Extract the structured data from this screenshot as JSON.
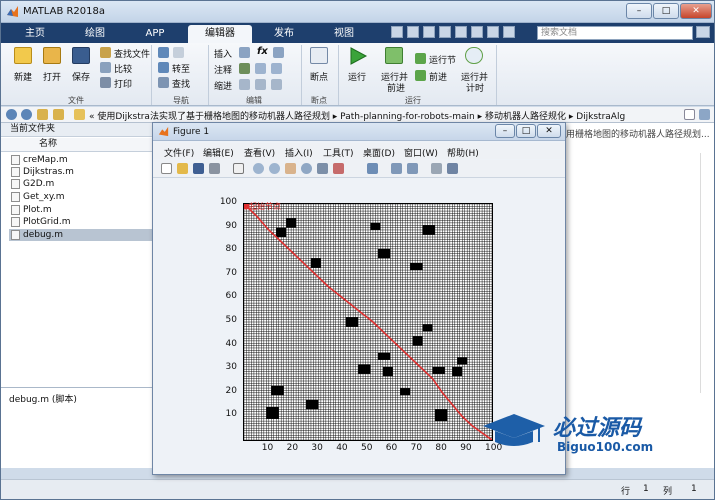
{
  "app": {
    "title": "MATLAB R2018a"
  },
  "window_buttons": {
    "minimize": "–",
    "maximize": "□",
    "close": "✕"
  },
  "tabs": [
    {
      "label": "主页"
    },
    {
      "label": "绘图"
    },
    {
      "label": "APP"
    },
    {
      "label": "编辑器"
    },
    {
      "label": "发布"
    },
    {
      "label": "视图"
    }
  ],
  "search": {
    "placeholder": "搜索文档"
  },
  "ribbon": {
    "file": {
      "new": "新建",
      "open": "打开",
      "save": "保存",
      "find_files": "查找文件",
      "compare": "比较",
      "print": "打印",
      "group": "文件"
    },
    "nav": {
      "goto": "转至",
      "find": "查找",
      "group": "导航"
    },
    "edit": {
      "insert": "插入",
      "comment": "注释",
      "indent": "缩进",
      "fx": "fx",
      "group": "编辑"
    },
    "breakpoints": {
      "label": "断点",
      "group": "断点"
    },
    "run": {
      "run": "运行",
      "run_advance_1": "运行并",
      "run_advance_2": "前进",
      "run_section": "运行节",
      "advance": "前进",
      "run_time_1": "运行并",
      "run_time_2": "计时",
      "group": "运行"
    }
  },
  "address": {
    "path": "«  使用Dijkstra法实现了基于栅格地图的移动机器人路径规划  ▸  Path-planning-for-robots-main  ▸  移动机器人路径规化  ▸  DijkstraAlg"
  },
  "left_panel": {
    "title": "当前文件夹",
    "column": "名称",
    "files": [
      "creMap.m",
      "Dijkstras.m",
      "G2D.m",
      "Get_xy.m",
      "Plot.m",
      "PlotGrid.m",
      "debug.m"
    ],
    "detail": "debug.m  (脚本)"
  },
  "right_panel": {
    "snippet": "用栅格地图的移动机器人路径规划..."
  },
  "status": {
    "row_label": "行",
    "row_value": "1",
    "col_label": "列",
    "col_value": "1"
  },
  "figure": {
    "title": "Figure 1",
    "menu": [
      "文件(F)",
      "编辑(E)",
      "查看(V)",
      "插入(I)",
      "工具(T)",
      "桌面(D)",
      "窗口(W)",
      "帮助(H)"
    ],
    "start_label": "起始节点"
  },
  "chart_data": {
    "type": "scatter",
    "title": "",
    "xlabel": "",
    "ylabel": "",
    "xlim": [
      0,
      100
    ],
    "ylim": [
      0,
      100
    ],
    "xticks": [
      10,
      20,
      30,
      40,
      50,
      60,
      70,
      80,
      90,
      100
    ],
    "yticks": [
      10,
      20,
      30,
      40,
      50,
      60,
      70,
      80,
      90,
      100
    ],
    "grid": "on",
    "obstacles": [
      {
        "x": 17,
        "y": 90,
        "w": 4,
        "h": 4
      },
      {
        "x": 13,
        "y": 86,
        "w": 4,
        "h": 4
      },
      {
        "x": 27,
        "y": 73,
        "w": 4,
        "h": 4
      },
      {
        "x": 51,
        "y": 89,
        "w": 4,
        "h": 3
      },
      {
        "x": 54,
        "y": 77,
        "w": 5,
        "h": 4
      },
      {
        "x": 72,
        "y": 87,
        "w": 5,
        "h": 4
      },
      {
        "x": 67,
        "y": 72,
        "w": 5,
        "h": 3
      },
      {
        "x": 41,
        "y": 48,
        "w": 5,
        "h": 4
      },
      {
        "x": 72,
        "y": 46,
        "w": 4,
        "h": 3
      },
      {
        "x": 68,
        "y": 40,
        "w": 4,
        "h": 4
      },
      {
        "x": 54,
        "y": 34,
        "w": 5,
        "h": 3
      },
      {
        "x": 46,
        "y": 28,
        "w": 5,
        "h": 4
      },
      {
        "x": 56,
        "y": 27,
        "w": 4,
        "h": 4
      },
      {
        "x": 86,
        "y": 32,
        "w": 4,
        "h": 3
      },
      {
        "x": 76,
        "y": 28,
        "w": 5,
        "h": 3
      },
      {
        "x": 84,
        "y": 27,
        "w": 4,
        "h": 4
      },
      {
        "x": 63,
        "y": 19,
        "w": 4,
        "h": 3
      },
      {
        "x": 11,
        "y": 19,
        "w": 5,
        "h": 4
      },
      {
        "x": 25,
        "y": 13,
        "w": 5,
        "h": 4
      },
      {
        "x": 9,
        "y": 9,
        "w": 5,
        "h": 5
      },
      {
        "x": 77,
        "y": 8,
        "w": 5,
        "h": 5
      }
    ],
    "path": {
      "x": [
        0,
        5,
        10,
        16,
        22,
        28,
        34,
        40,
        46,
        52,
        58,
        64,
        70,
        76,
        80,
        84,
        88,
        92,
        96,
        100
      ],
      "y": [
        100,
        95,
        89,
        83,
        77,
        71,
        65,
        60,
        55,
        50,
        44,
        38,
        32,
        26,
        20,
        15,
        10,
        6,
        3,
        0
      ]
    },
    "start": {
      "x": 0,
      "y": 100
    }
  },
  "watermark": {
    "brand": "必过源码",
    "url": "Biguo100.com"
  },
  "colors": {
    "path": "#e03030",
    "tabbar": "#1e3f6d",
    "obstacle": "#000000"
  }
}
